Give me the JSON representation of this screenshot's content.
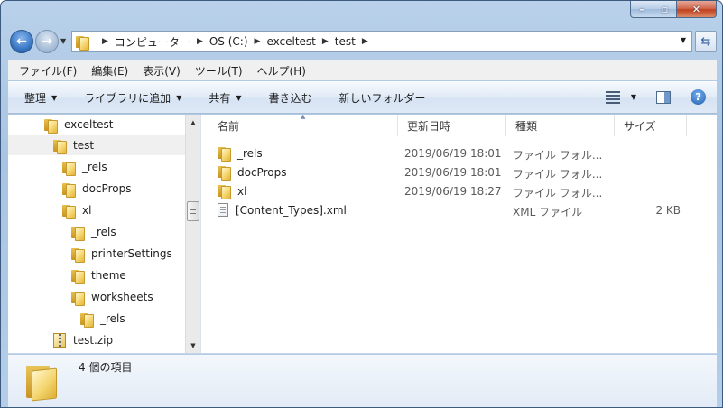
{
  "address": {
    "crumbs": [
      "コンピューター",
      "OS (C:)",
      "exceltest",
      "test"
    ]
  },
  "menu": [
    "ファイル(F)",
    "編集(E)",
    "表示(V)",
    "ツール(T)",
    "ヘルプ(H)"
  ],
  "commands": {
    "organize": "整理",
    "library": "ライブラリに追加",
    "share": "共有",
    "burn": "書き込む",
    "new_folder": "新しいフォルダー"
  },
  "tree": [
    {
      "label": "exceltest",
      "icon": "folder",
      "indent": 0
    },
    {
      "label": "test",
      "icon": "folder",
      "indent": 1,
      "selected": true
    },
    {
      "label": "_rels",
      "icon": "folder",
      "indent": 2
    },
    {
      "label": "docProps",
      "icon": "folder",
      "indent": 2
    },
    {
      "label": "xl",
      "icon": "folder",
      "indent": 2
    },
    {
      "label": "_rels",
      "icon": "folder",
      "indent": 3
    },
    {
      "label": "printerSettings",
      "icon": "folder",
      "indent": 3
    },
    {
      "label": "theme",
      "icon": "folder",
      "indent": 3
    },
    {
      "label": "worksheets",
      "icon": "folder",
      "indent": 3
    },
    {
      "label": "_rels",
      "icon": "folder",
      "indent": 4
    },
    {
      "label": "test.zip",
      "icon": "zip",
      "indent": 1
    }
  ],
  "columns": {
    "name": "名前",
    "date": "更新日時",
    "type": "種類",
    "size": "サイズ"
  },
  "files": [
    {
      "name": "_rels",
      "date": "2019/06/19 18:01",
      "type": "ファイル フォル...",
      "size": "",
      "icon": "folder"
    },
    {
      "name": "docProps",
      "date": "2019/06/19 18:01",
      "type": "ファイル フォル...",
      "size": "",
      "icon": "folder"
    },
    {
      "name": "xl",
      "date": "2019/06/19 18:27",
      "type": "ファイル フォル...",
      "size": "",
      "icon": "folder"
    },
    {
      "name": "[Content_Types].xml",
      "date": "",
      "type": "XML ファイル",
      "size": "2 KB",
      "icon": "xml"
    }
  ],
  "status": {
    "text": "4 個の項目"
  },
  "colors": {
    "frame": "#b9d1ea",
    "selected": "#f0f0f0",
    "accent": "#3a78c5"
  }
}
